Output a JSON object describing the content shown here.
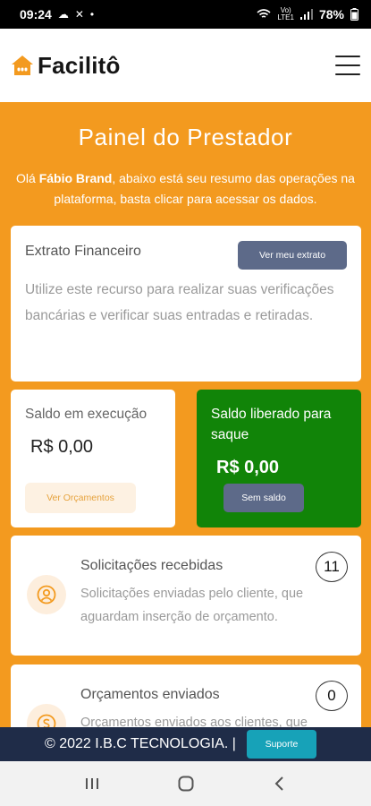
{
  "status_bar": {
    "time": "09:24",
    "network_top": "Vo)",
    "network_bottom": "LTE1",
    "battery": "78%"
  },
  "header": {
    "brand": "Facilitô"
  },
  "main": {
    "title": "Painel do Prestador",
    "greeting_prefix": "Olá ",
    "user_name": "Fábio Brand",
    "greeting_suffix": ", abaixo está seu resumo das operações na plataforma, basta clicar para acessar os dados."
  },
  "extrato": {
    "title": "Extrato Financeiro",
    "button": "Ver meu extrato",
    "description": "Utilize este recurso para realizar suas verificações bancárias e verificar suas entradas e retiradas."
  },
  "saldo_execucao": {
    "title": "Saldo em execução",
    "amount": "R$ 0,00",
    "button": "Ver Orçamentos"
  },
  "saldo_liberado": {
    "title": "Saldo liberado para saque",
    "amount": "R$ 0,00",
    "button": "Sem saldo"
  },
  "solicitacoes": {
    "title": "Solicitações recebidas",
    "description": "Solicitações enviadas pelo cliente, que aguardam inserção de orçamento.",
    "count": "11"
  },
  "orcamentos": {
    "title": "Orçamentos enviados",
    "description": "Orçamentos enviados aos clientes, que",
    "count": "0"
  },
  "footer": {
    "copyright": "© 2022 I.B.C TECNOLOGIA. |",
    "support_button": "Suporte"
  },
  "colors": {
    "orange": "#f39a1f",
    "green": "#118408",
    "slate": "#5d6a89",
    "footer": "#1f2c48",
    "support": "#17a2b8"
  }
}
